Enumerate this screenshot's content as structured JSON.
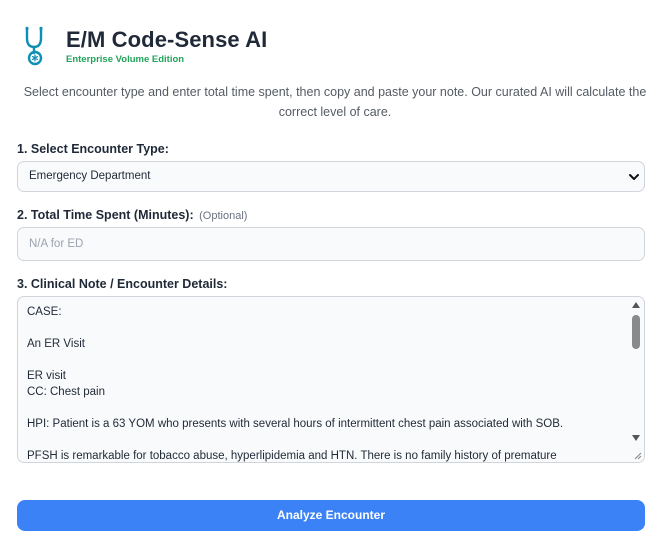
{
  "header": {
    "title": "E/M Code-Sense AI",
    "subtitle": "Enterprise Volume Edition",
    "logo_icon": "stethoscope-icon"
  },
  "intro": {
    "line1": "Select encounter type and enter total time spent, then copy and paste your note. Our curated AI will calculate the",
    "line2": "correct level of care."
  },
  "form": {
    "encounter_type": {
      "label": "1. Select Encounter Type:",
      "selected": "Emergency Department"
    },
    "time_spent": {
      "label": "2. Total Time Spent (Minutes):",
      "optional": "(Optional)",
      "placeholder": "N/A for ED"
    },
    "note": {
      "label": "3. Clinical Note / Encounter Details:",
      "lines": [
        "CASE:",
        "An ER Visit",
        "ER visit",
        "CC: Chest pain",
        "HPI: Patient is a 63 YOM  who presents with several hours of intermittent chest pain associated with SOB.",
        "PFSH is remarkable for tobacco abuse, hyperlipidemia and HTN.  There is no family history of premature"
      ]
    },
    "submit_label": "Analyze Encounter"
  },
  "colors": {
    "accent": "#3b82f6",
    "subtitle_green": "#22a35a",
    "logo_teal": "#0e8fb5"
  }
}
